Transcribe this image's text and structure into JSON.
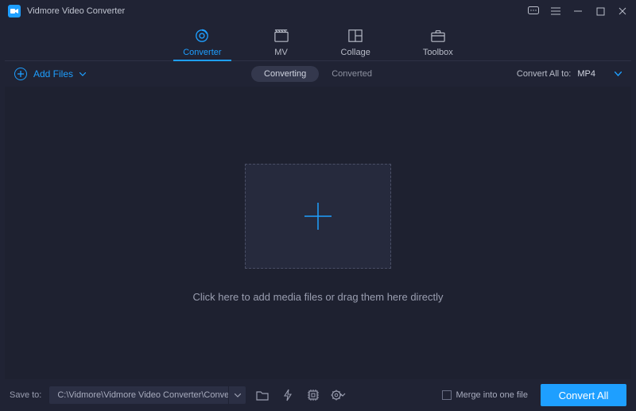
{
  "app": {
    "title": "Vidmore Video Converter"
  },
  "tabs": {
    "converter": "Converter",
    "mv": "MV",
    "collage": "Collage",
    "toolbox": "Toolbox"
  },
  "toolbar": {
    "add_files": "Add Files",
    "sub_converting": "Converting",
    "sub_converted": "Converted",
    "convert_all_to_label": "Convert All to:",
    "format_selected": "MP4"
  },
  "main": {
    "hint": "Click here to add media files or drag them here directly"
  },
  "bottom": {
    "save_to_label": "Save to:",
    "path": "C:\\Vidmore\\Vidmore Video Converter\\Converted",
    "merge_label": "Merge into one file",
    "convert_all_btn": "Convert All"
  },
  "colors": {
    "accent": "#1e9fff"
  }
}
